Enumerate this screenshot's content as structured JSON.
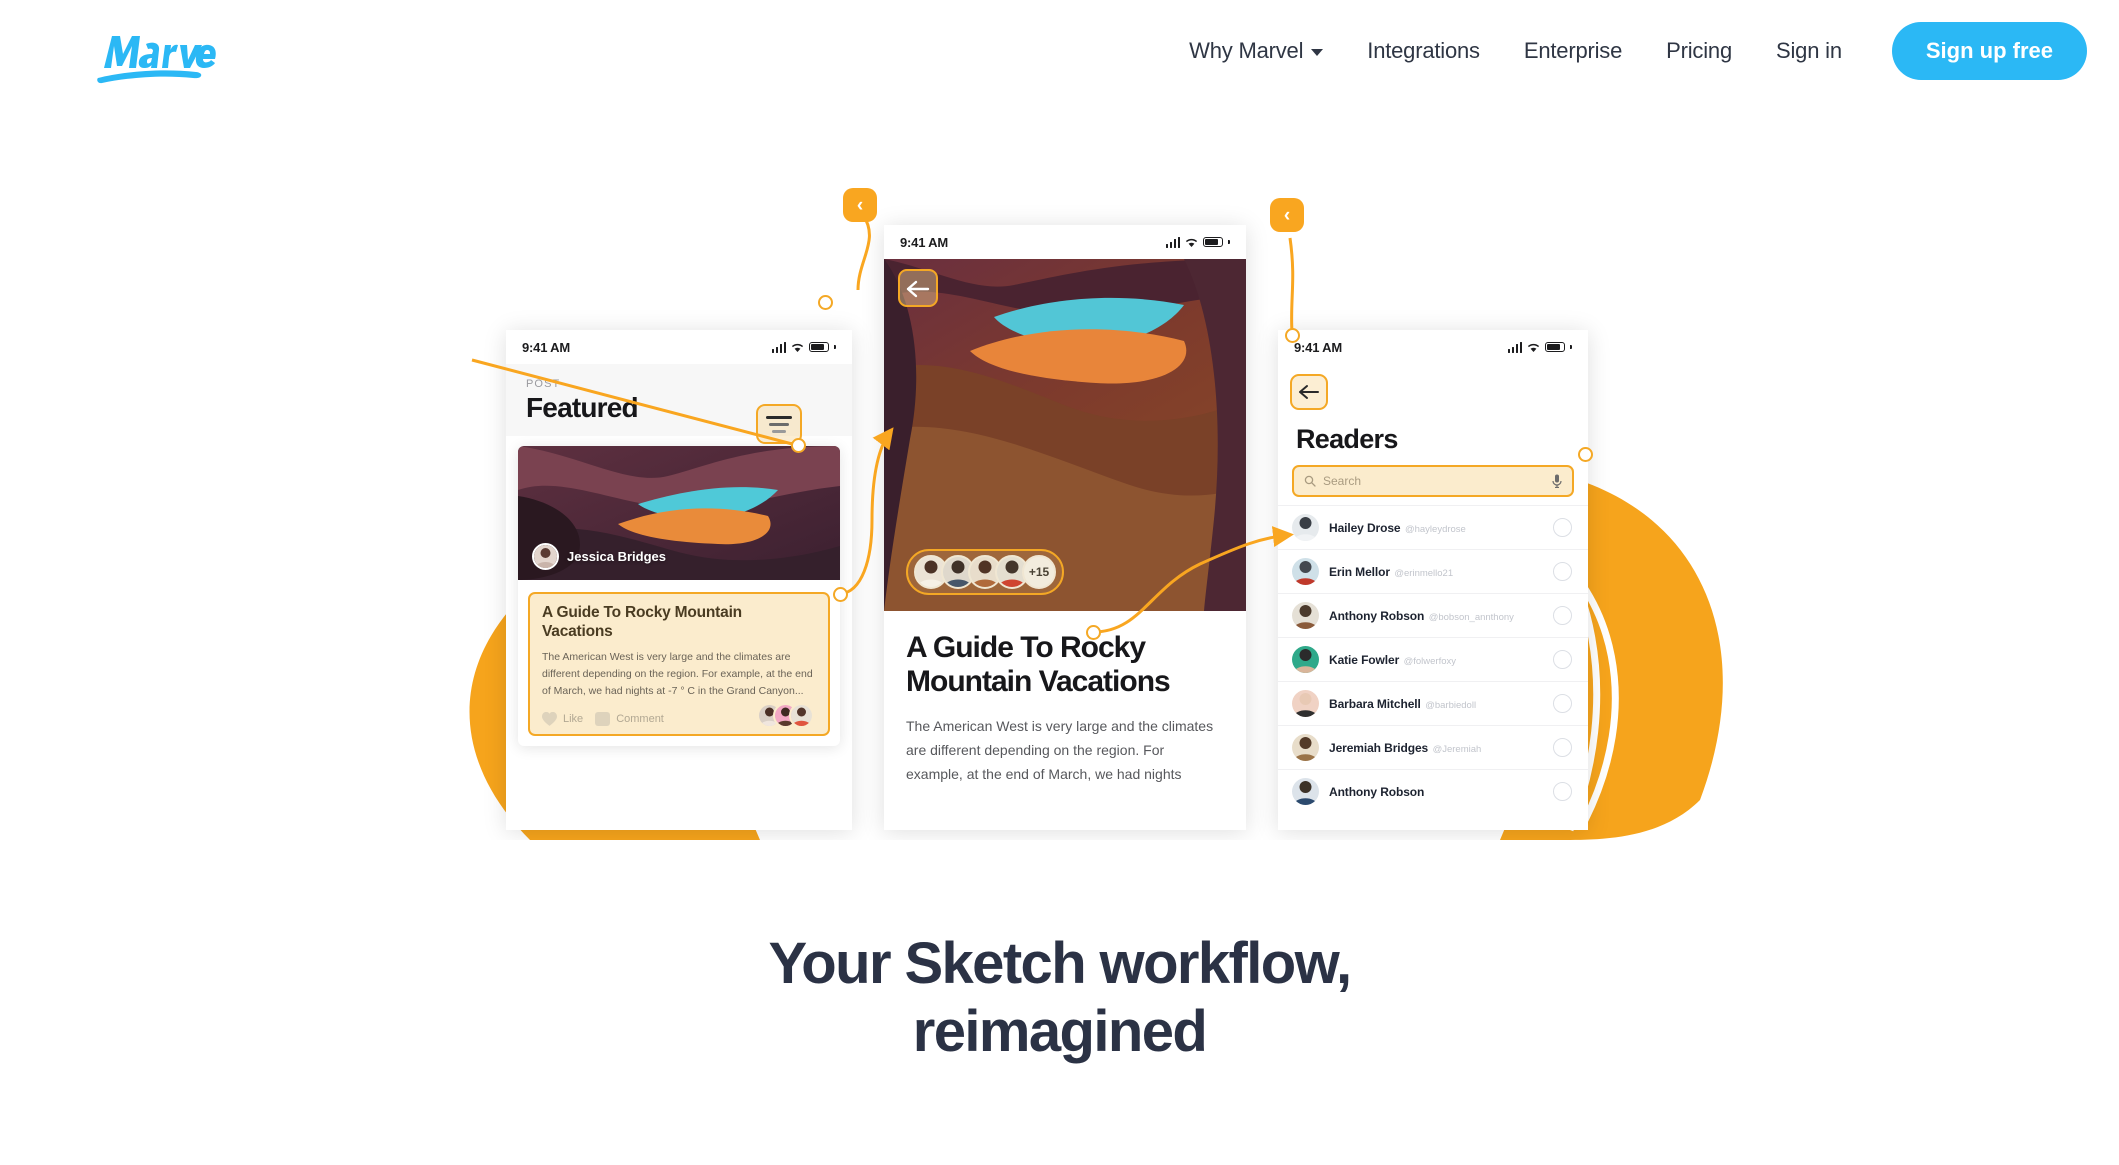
{
  "brand": {
    "name": "Marvel",
    "logo_color": "#2bb8f5"
  },
  "nav": {
    "items": [
      {
        "label": "Why Marvel",
        "has_caret": true
      },
      {
        "label": "Integrations",
        "has_caret": false
      },
      {
        "label": "Enterprise",
        "has_caret": false
      },
      {
        "label": "Pricing",
        "has_caret": false
      },
      {
        "label": "Sign in",
        "has_caret": false
      }
    ],
    "cta": {
      "label": "Sign up free",
      "color": "#2bb8f5"
    }
  },
  "hero": {
    "headline_line1": "Your Sketch workflow,",
    "headline_line2": "reimagined",
    "accent_color": "#f9a620",
    "selection_border": "#f4a825",
    "selection_fill": "#fbeccd"
  },
  "screens": {
    "left": {
      "status_time": "9:41 AM",
      "kicker": "POST",
      "title": "Featured",
      "author": "Jessica Bridges",
      "card_title": "A Guide To Rocky Mountain Vacations",
      "card_body": "The American West is very large and the climates are different depending on the region. For example, at the end of March, we had nights at -7 ° C in the Grand Canyon...",
      "like_label": "Like",
      "comment_label": "Comment"
    },
    "center": {
      "status_time": "9:41 AM",
      "avatar_overflow": "+15",
      "title": "A Guide To Rocky Mountain Vacations",
      "body": "The American West is very large and the climates are different depending on the region. For example, at the end of March, we had nights"
    },
    "right": {
      "status_time": "9:41 AM",
      "title": "Readers",
      "search_placeholder": "Search",
      "readers": [
        {
          "name": "Hailey Drose",
          "handle": "@hayleydrose"
        },
        {
          "name": "Erin Mellor",
          "handle": "@erinmello21"
        },
        {
          "name": "Anthony Robson",
          "handle": "@bobson_annthony"
        },
        {
          "name": "Katie Fowler",
          "handle": "@folwerfoxy"
        },
        {
          "name": "Barbara Mitchell",
          "handle": "@barbiedoll"
        },
        {
          "name": "Jeremiah Bridges",
          "handle": "@Jeremiah"
        },
        {
          "name": "Anthony Robson",
          "handle": ""
        }
      ]
    }
  },
  "markers": {
    "back_glyph": "‹"
  }
}
